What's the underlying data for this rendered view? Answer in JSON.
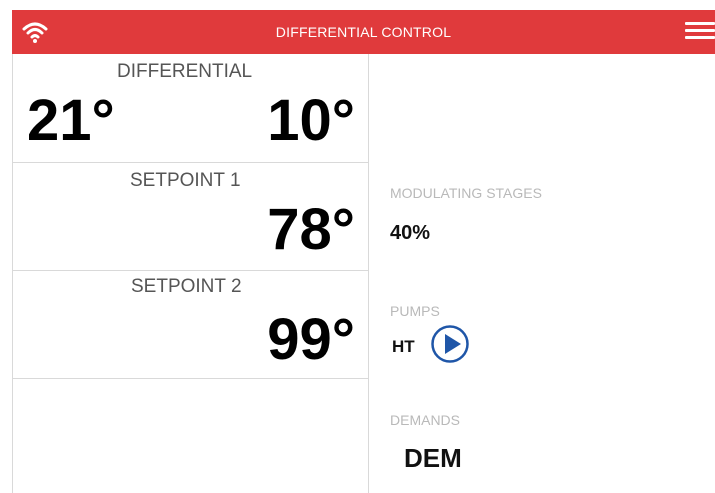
{
  "header": {
    "title": "DIFFERENTIAL CONTROL",
    "wifi_icon": "wifi-icon",
    "menu_icon": "hamburger-menu-icon",
    "background_color": "#e03a3c"
  },
  "panels": {
    "differential": {
      "label": "DIFFERENTIAL",
      "value_a": "21°",
      "value_b": "10°"
    },
    "setpoint1": {
      "label": "SETPOINT 1",
      "value": "78°"
    },
    "setpoint2": {
      "label": "SETPOINT 2",
      "value": "99°"
    }
  },
  "right": {
    "modulating": {
      "label": "MODULATING STAGES",
      "value": "40%"
    },
    "pumps": {
      "label": "PUMPS",
      "pump_name": "HT",
      "play_icon": "play-circle-icon",
      "play_color": "#1f56a8"
    },
    "demands": {
      "label": "DEMANDS",
      "value": "DEM"
    }
  }
}
